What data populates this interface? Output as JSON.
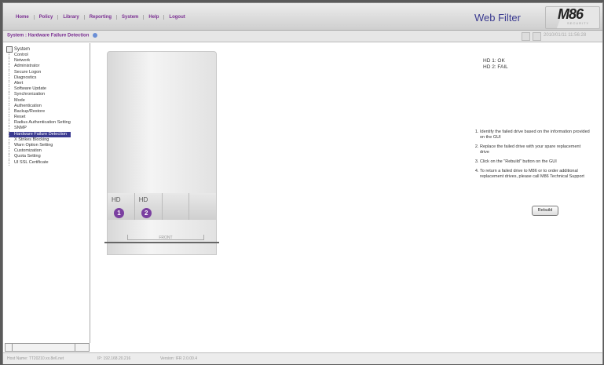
{
  "menu": {
    "items": [
      "Home",
      "Policy",
      "Library",
      "Reporting",
      "System",
      "Help",
      "Logout"
    ]
  },
  "brand": {
    "product": "Web Filter",
    "logo": "M86",
    "sub": "SECURITY"
  },
  "breadcrumb": {
    "text": "System : Hardware Failure Detection",
    "timestamp": "2010/01/11 11:56:28"
  },
  "tree": {
    "root": "System",
    "items": [
      "Control",
      "Network",
      "Administrator",
      "Secure Logon",
      "Diagnostics",
      "Alert",
      "Software Update",
      "Synchronization",
      "Mode",
      "Authentication",
      "Backup/Restore",
      "Reset",
      "Radius Authentication Setting",
      "SNMP",
      "Hardware Failure Detection",
      "X Strikes Blocking",
      "Warn Option Setting",
      "Customization",
      "Quota Setting",
      "UI SSL Certificate"
    ],
    "selected_index": 14
  },
  "drives": [
    {
      "label": "HD",
      "number": "1"
    },
    {
      "label": "HD",
      "number": "2"
    }
  ],
  "front_label": "FRONT",
  "status": {
    "hd1": "HD 1: OK",
    "hd2": "HD 2: FAIL"
  },
  "instructions": [
    "Identify the failed drive based on the information provided on the GUI",
    "Replace the failed drive with your spare replacement drive",
    "Click on the \"Rebuild\" button on the GUI",
    "To return a failed drive to M86 or to order additional replacement drives, please call M86 Technical Support"
  ],
  "rebuild_label": "Rebuild",
  "footer": {
    "host": "Host Name: TT20210.xx.8e6.net",
    "ip": "IP: 192.168.20.216",
    "version": "Version: IFR 2.0.00.4"
  }
}
